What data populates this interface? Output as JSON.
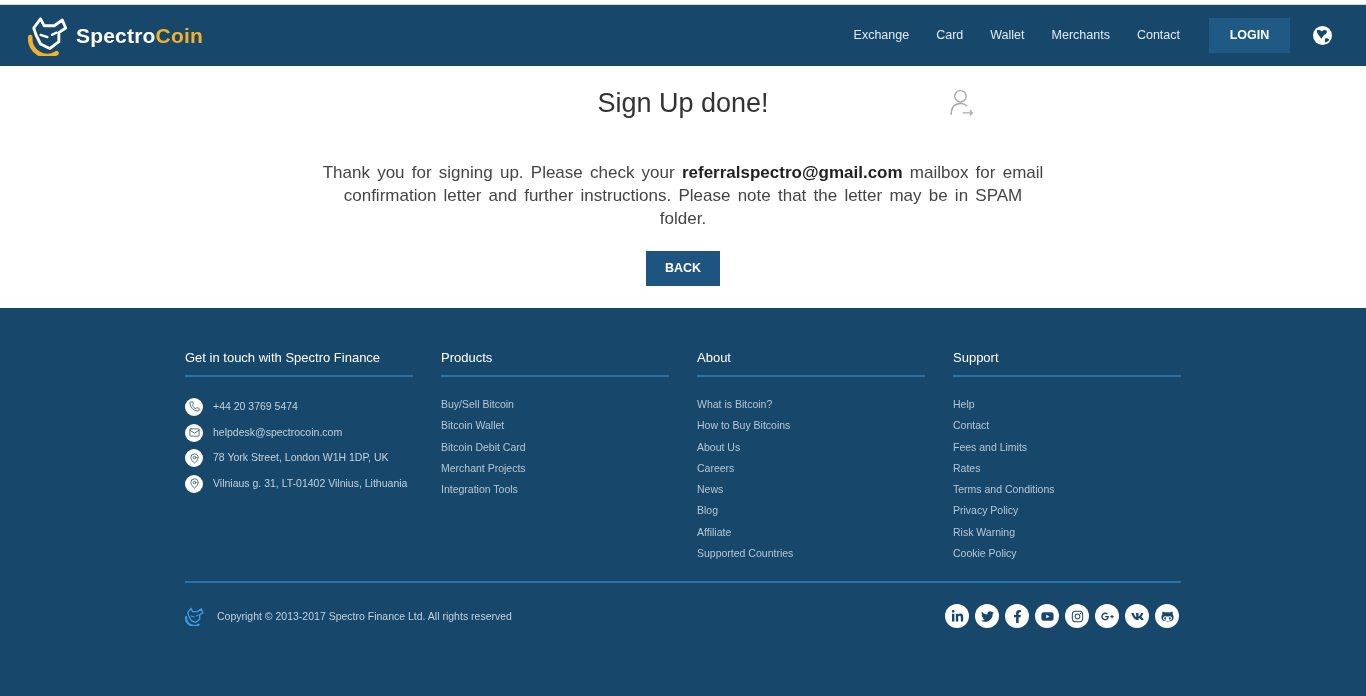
{
  "header": {
    "logo": {
      "text_1": "Spectro",
      "text_2": "Coin"
    },
    "nav": [
      "Exchange",
      "Card",
      "Wallet",
      "Merchants",
      "Contact"
    ],
    "login_button": "LOGIN"
  },
  "main": {
    "title": "Sign Up done!",
    "message": "Thank you for signing up. Please check your **referralspectro@gmail.com** mailbox for email confirmation letter and further instructions. Please note that the letter may be in SPAM folder.",
    "back_button": "BACK"
  },
  "footer": {
    "columns": [
      {
        "kind": "contact",
        "heading": "Get in touch with Spectro Finance",
        "items": [
          {
            "kind": "phone",
            "text": "+44 20 3769 5474"
          },
          {
            "kind": "email",
            "text": "helpdesk@spectrocoin.com"
          },
          {
            "kind": "address",
            "text": "78 York Street, London W1H 1DP, UK"
          },
          {
            "kind": "address",
            "text": "Vilniaus g. 31, LT-01402 Vilnius, Lithuania"
          }
        ]
      },
      {
        "kind": "links",
        "heading": "Products",
        "items": [
          {
            "text": "Buy/Sell Bitcoin"
          },
          {
            "text": "Bitcoin Wallet"
          },
          {
            "text": "Bitcoin Debit Card"
          },
          {
            "text": "Merchant Projects"
          },
          {
            "text": "Integration Tools"
          }
        ]
      },
      {
        "kind": "links",
        "heading": "About",
        "items": [
          {
            "text": "What is Bitcoin?"
          },
          {
            "text": "How to Buy Bitcoins"
          },
          {
            "text": "About Us"
          },
          {
            "text": "Careers"
          },
          {
            "text": "News"
          },
          {
            "text": "Blog"
          },
          {
            "text": "Affiliate"
          },
          {
            "text": "Supported Countries"
          }
        ]
      },
      {
        "kind": "links",
        "heading": "Support",
        "items": [
          {
            "text": "Help"
          },
          {
            "text": "Contact"
          },
          {
            "text": "Fees and Limits"
          },
          {
            "text": "Rates"
          },
          {
            "text": "Terms and Conditions"
          },
          {
            "text": "Privacy Policy"
          },
          {
            "text": "Risk Warning"
          },
          {
            "text": "Cookie Policy"
          }
        ]
      }
    ],
    "copyright": "Copyright © 2013-2017 Spectro Finance Ltd. All rights reserved"
  }
}
